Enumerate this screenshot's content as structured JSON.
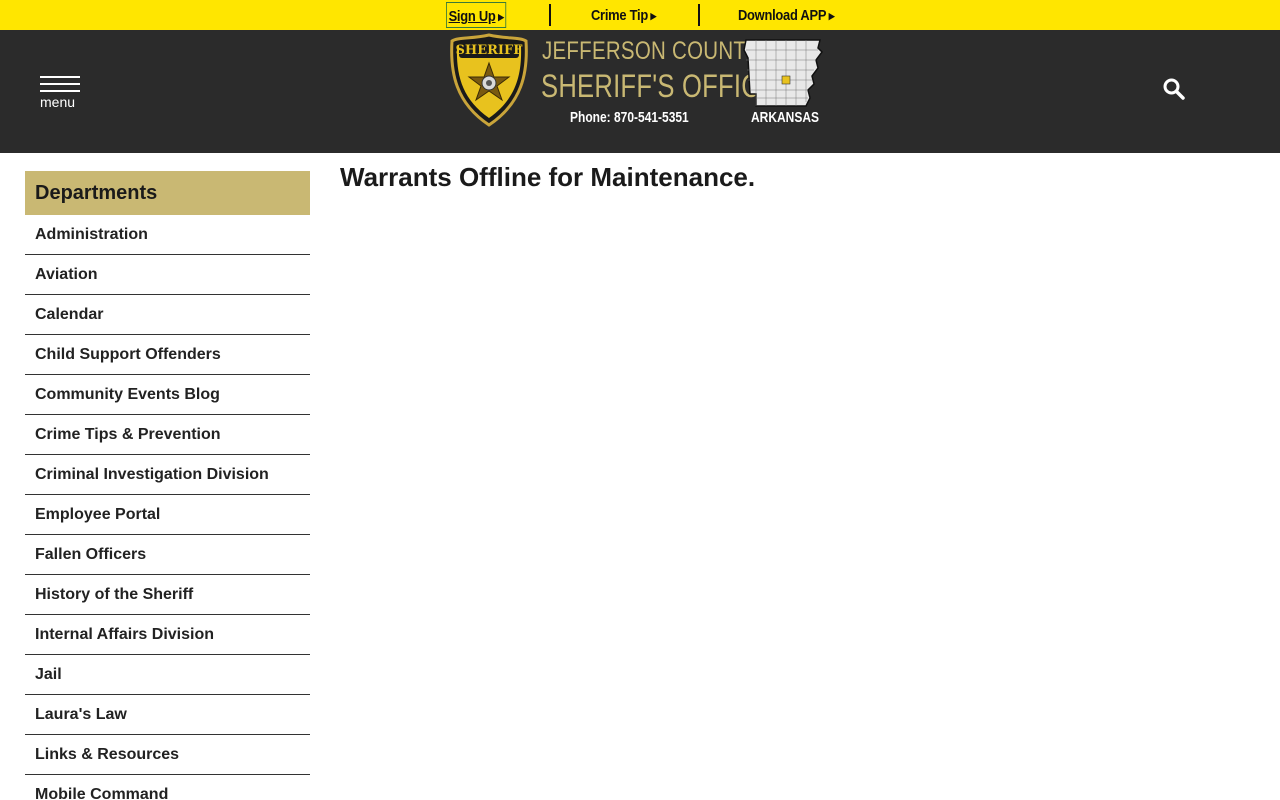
{
  "topbar": {
    "signup": "Sign Up",
    "crime_tip": "Crime Tip",
    "download_app": "Download APP"
  },
  "header": {
    "badge_text": "SHERIFF",
    "badge_county": "JEFFERSON",
    "title_line1": "JEFFERSON COUNTY",
    "title_line2": "SHERIFF'S OFFICE",
    "phone": "Phone: 870-541-5351",
    "state": "ARKANSAS",
    "menu_label": "menu"
  },
  "sidebar": {
    "heading": "Departments",
    "items": [
      "Administration",
      "Aviation",
      "Calendar",
      "Child Support Offenders",
      "Community Events Blog",
      "Crime Tips & Prevention",
      "Criminal Investigation Division",
      "Employee Portal",
      "Fallen Officers",
      "History of the Sheriff",
      "Internal Affairs Division",
      "Jail",
      "Laura's Law",
      "Links & Resources",
      "Mobile Command"
    ]
  },
  "main": {
    "title": "Warrants Offline for Maintenance."
  },
  "colors": {
    "topbar": "#ffe600",
    "header": "#2b2b2b",
    "gold": "#c9b873"
  }
}
